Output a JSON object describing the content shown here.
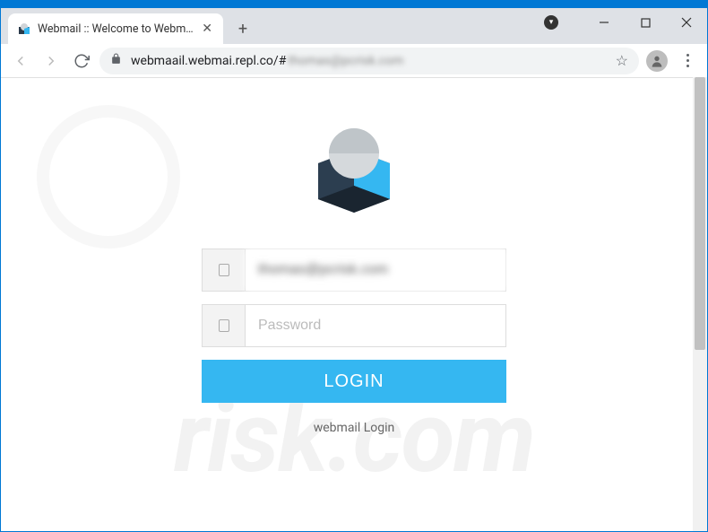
{
  "window": {
    "tab_title": "Webmail :: Welcome to Webmail"
  },
  "toolbar": {
    "url_visible": "webmaail.webmai.repl.co/#",
    "url_blurred": "thomas@pcrisk.com"
  },
  "login": {
    "email_value": "thomas@pcrisk.com",
    "password_placeholder": "Password",
    "button_label": "LOGIN",
    "footer_label": "webmail Login"
  },
  "watermark": {
    "text": "risk.com"
  }
}
